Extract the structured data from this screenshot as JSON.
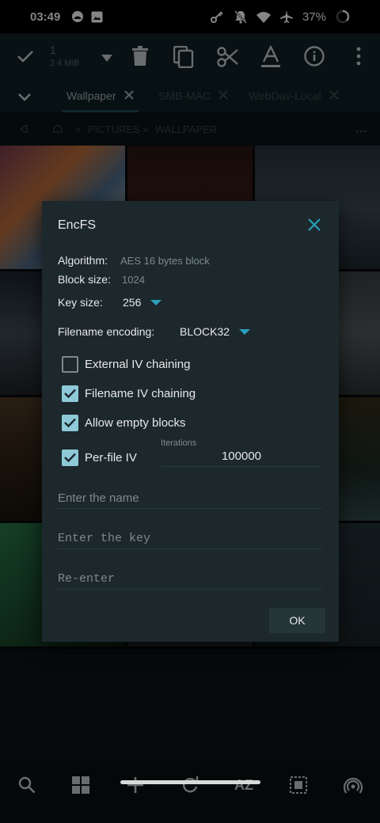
{
  "status_bar": {
    "time": "03:49",
    "battery": "37%",
    "left_icons": [
      "cloud-icon",
      "image-icon"
    ],
    "right_icons": [
      "vpn-key-icon",
      "notifications-off-icon",
      "wifi-icon",
      "airplane-icon",
      "battery-ring-icon"
    ]
  },
  "toolbar": {
    "selected_count": "1",
    "selected_size": "2.4 MiB",
    "actions": [
      "check-icon",
      "dropdown-icon",
      "delete-icon",
      "copy-icon",
      "cut-icon",
      "rename-icon",
      "info-icon",
      "more-icon"
    ]
  },
  "tabs": [
    {
      "label": "Wallpaper",
      "active": true
    },
    {
      "label": "SMB-MAC",
      "active": false
    },
    {
      "label": "WebDav-Local",
      "active": false
    }
  ],
  "breadcrumb": {
    "segments": [
      "PICTURES",
      "WALLPAPER"
    ],
    "separator": "»"
  },
  "bottom_bar": {
    "icons": [
      "search-icon",
      "grid-view-icon",
      "add-icon",
      "refresh-icon",
      "sort-az-icon",
      "select-all-icon",
      "cast-icon"
    ],
    "sort_label": "AZ"
  },
  "dialog": {
    "title": "EncFS",
    "algorithm_label": "Algorithm:",
    "algorithm_value": "AES 16 bytes block",
    "block_size_label": "Block size:",
    "block_size_value": "1024",
    "key_size_label": "Key size:",
    "key_size_value": "256",
    "filename_encoding_label": "Filename encoding:",
    "filename_encoding_value": "BLOCK32",
    "checkboxes": [
      {
        "label": "External IV chaining",
        "checked": false
      },
      {
        "label": "Filename IV chaining",
        "checked": true
      },
      {
        "label": "Allow empty blocks",
        "checked": true
      },
      {
        "label": "Per-file IV",
        "checked": true
      }
    ],
    "iterations_label": "Iterations",
    "iterations_value": "100000",
    "name_placeholder": "Enter the name",
    "key_placeholder": "Enter the key",
    "reenter_placeholder": "Re-enter",
    "ok_label": "OK"
  },
  "colors": {
    "accent": "#2a9fbb",
    "checkbox_on": "#8ec9d8",
    "dialog_bg": "#1c282c",
    "toolbar_bg": "#112126"
  }
}
